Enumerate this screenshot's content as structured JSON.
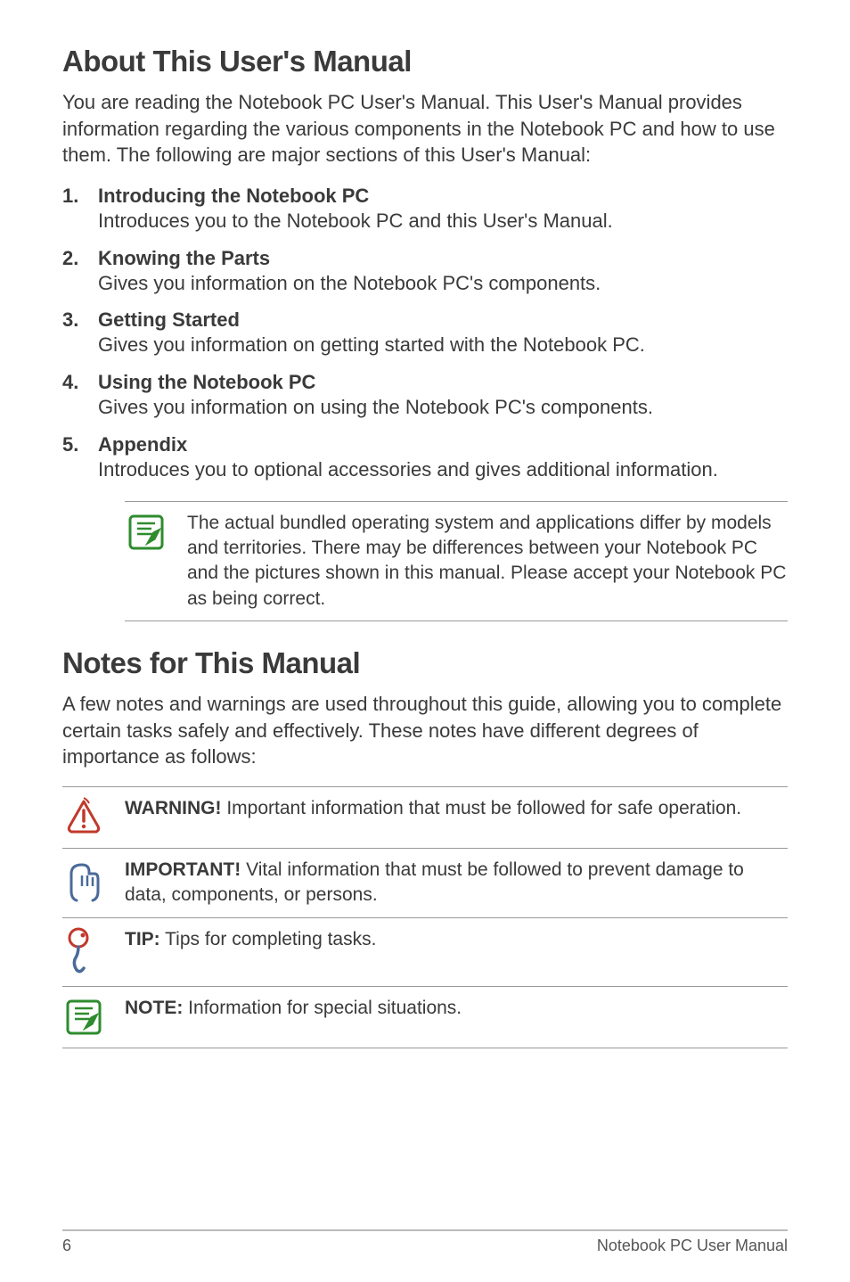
{
  "section1": {
    "heading": "About This User's Manual",
    "intro": "You are reading the Notebook PC User's Manual. This User's Manual provides information regarding the various components in the Notebook PC and how to use them. The following are major sections of this User's Manual:",
    "items": [
      {
        "num": "1.",
        "title": "Introducing the Notebook PC",
        "desc": "Introduces you to the Notebook PC and this User's Manual."
      },
      {
        "num": "2.",
        "title": "Knowing the Parts",
        "desc": "Gives you information on the Notebook PC's components."
      },
      {
        "num": "3.",
        "title": "Getting Started",
        "desc": "Gives you information on getting started with the Notebook PC."
      },
      {
        "num": "4.",
        "title": "Using the Notebook PC",
        "desc": "Gives you information on using the Notebook PC's components."
      },
      {
        "num": "5.",
        "title": "Appendix",
        "desc": "Introduces you to optional accessories and gives additional information."
      }
    ],
    "note": "The actual bundled operating system and applications differ by models and territories. There may be differences between your Notebook PC and the pictures shown in this manual. Please accept your Notebook PC as being correct."
  },
  "section2": {
    "heading": "Notes for This Manual",
    "intro": "A few notes and warnings are used throughout this guide, allowing you to complete certain tasks safely and effectively. These notes have different degrees of importance as follows:",
    "notes": [
      {
        "label": "WARNING!",
        "text": " Important information that must be followed for safe operation."
      },
      {
        "label": "IMPORTANT!",
        "text": " Vital information that must be followed to prevent damage to data, components, or persons."
      },
      {
        "label": "TIP:",
        "text": " Tips for completing tasks."
      },
      {
        "label": "NOTE:",
        "text": "  Information for special situations."
      }
    ]
  },
  "footer": {
    "page": "6",
    "title": "Notebook PC User Manual"
  }
}
